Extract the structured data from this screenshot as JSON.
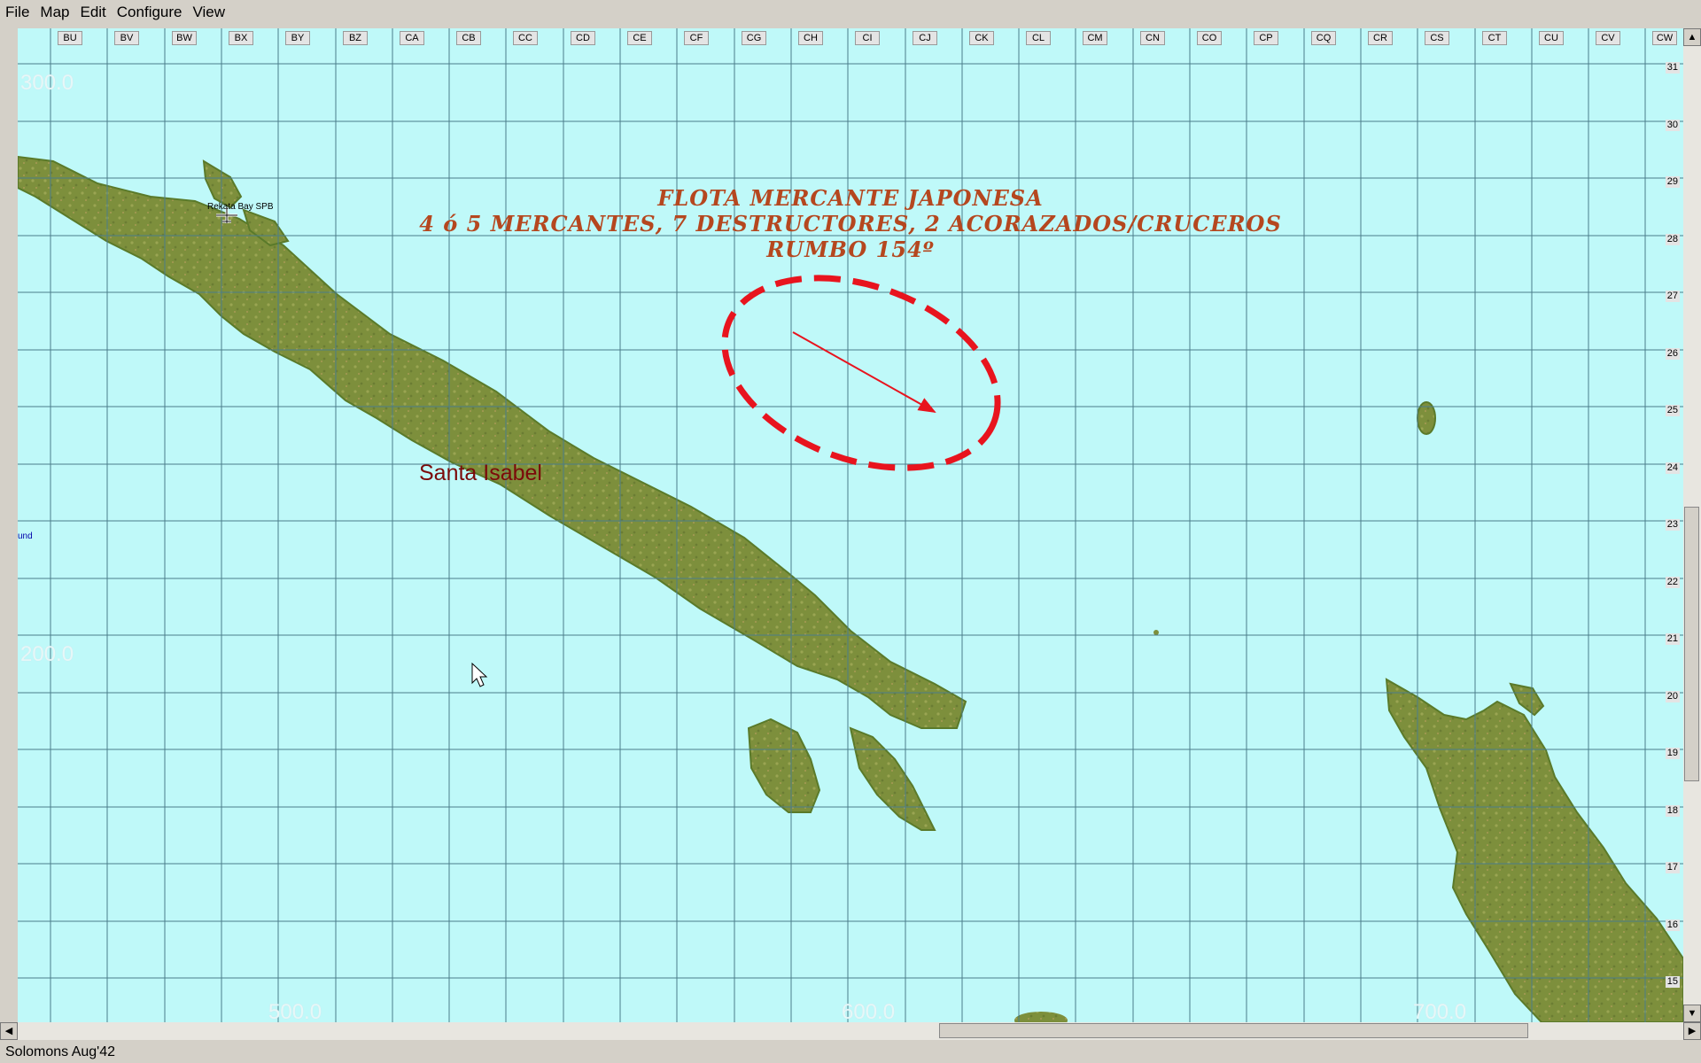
{
  "menu": [
    "File",
    "Map",
    "Edit",
    "Configure",
    "View"
  ],
  "columns": [
    "BU",
    "BV",
    "BW",
    "BX",
    "BY",
    "BZ",
    "CA",
    "CB",
    "CC",
    "CD",
    "CE",
    "CF",
    "CG",
    "CH",
    "CI",
    "CJ",
    "CK",
    "CL",
    "CM",
    "CN",
    "CO",
    "CP",
    "CQ",
    "CR",
    "CS",
    "CT",
    "CU",
    "CV",
    "CW"
  ],
  "rows": [
    "31",
    "30",
    "29",
    "28",
    "27",
    "26",
    "25",
    "24",
    "23",
    "22",
    "21",
    "20",
    "19",
    "18",
    "17",
    "16",
    "15"
  ],
  "coords": {
    "y300": "300.0",
    "y200": "200.0",
    "x500": "500.0",
    "x600": "600.0",
    "x700": "700.0"
  },
  "annotation": {
    "line1": "FLOTA MERCANTE JAPONESA",
    "line2": "4 ó 5 MERCANTES, 7 DESTRUCTORES, 2 ACORAZADOS/CRUCEROS",
    "line3": "RUMBO 154º"
  },
  "map_labels": {
    "island": "Santa Isabel",
    "base": "Rekata Bay SPB",
    "edge": "und"
  },
  "status": "Solomons Aug'42",
  "colors": {
    "sea": "#bff9f9",
    "land": "#7d8f3c",
    "annotation": "#b5471f",
    "ellipse": "#e8141e"
  },
  "icons": {
    "base": "seaplane-icon",
    "cursor": "mouse-pointer-icon"
  }
}
